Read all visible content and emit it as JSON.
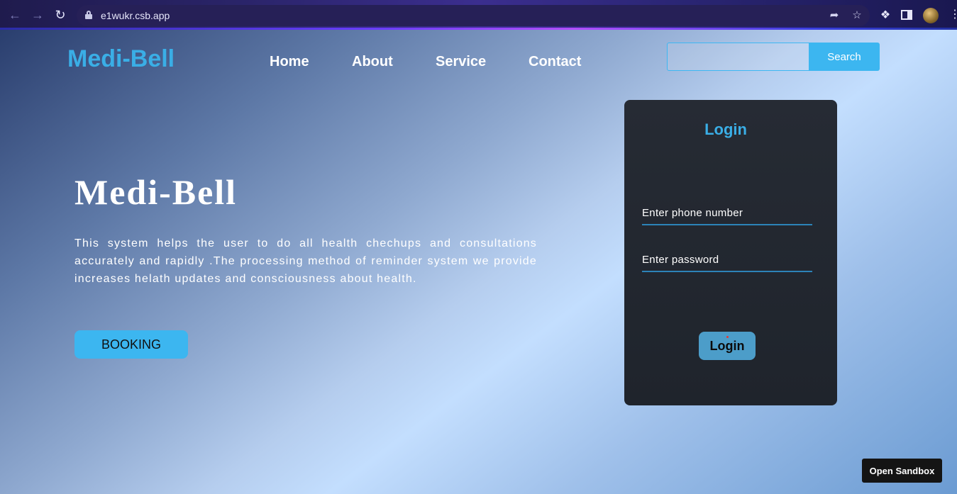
{
  "browser": {
    "url": "e1wukr.csb.app",
    "icons": [
      "back-icon",
      "forward-icon",
      "reload-icon",
      "lock-icon",
      "share-icon",
      "star-icon",
      "extensions-icon",
      "side-panel-icon",
      "profile-avatar",
      "menu-icon"
    ]
  },
  "header": {
    "brand": "Medi-Bell",
    "nav": [
      "Home",
      "About",
      "Service",
      "Contact"
    ],
    "search_placeholder": "",
    "search_button": "Search"
  },
  "hero": {
    "title": "Medi-Bell",
    "description": "This system helps the user to do all health chechups and consultations accurately and rapidly .The processing method of reminder system we provide increases helath updates and consciousness about health.",
    "booking_button": "BOOKING"
  },
  "login": {
    "title": "Login",
    "phone_label": "Enter phone number",
    "password_label": "Enter password",
    "button": "Login"
  },
  "footer": {
    "sandbox_button": "Open Sandbox"
  },
  "colors": {
    "accent": "#3cb6f0",
    "brand": "#3aaee6",
    "card": "#23282f",
    "login_button": "#4c9dc9"
  }
}
